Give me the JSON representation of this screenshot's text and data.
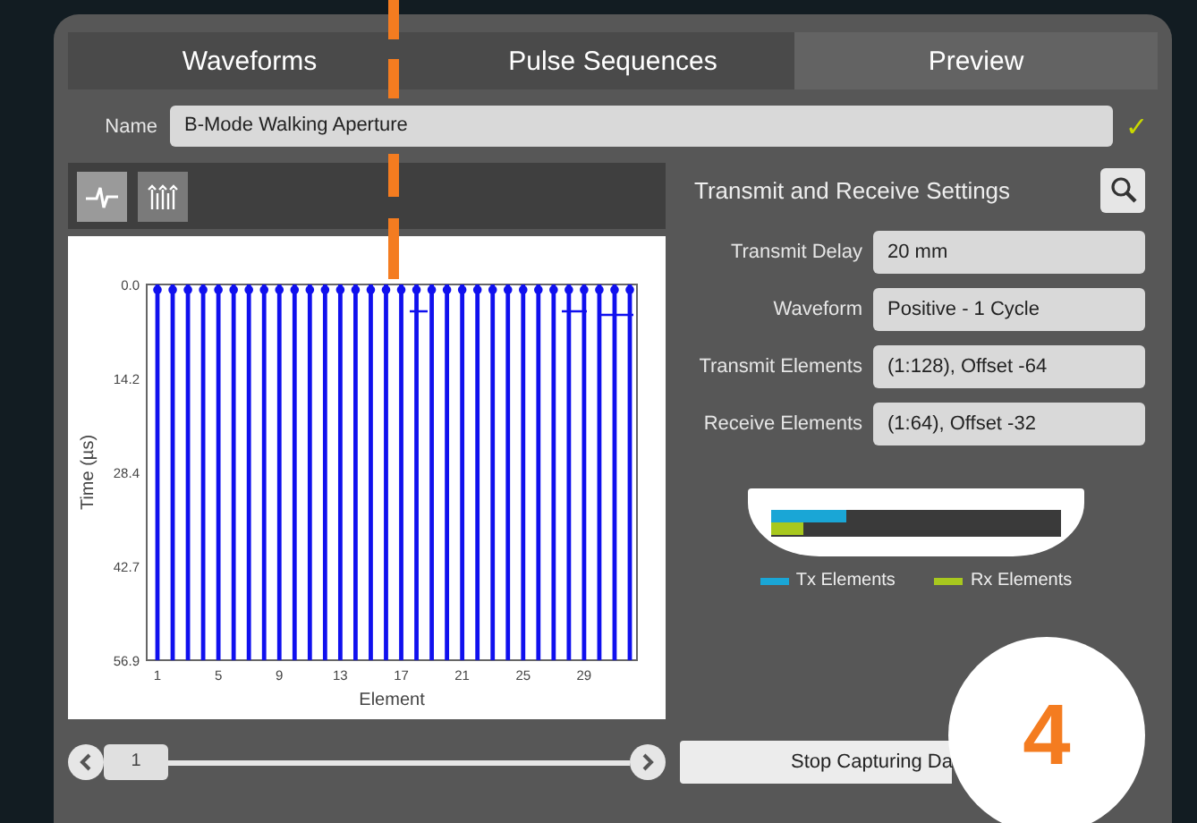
{
  "tabs": [
    {
      "label": "Waveforms",
      "selected": false
    },
    {
      "label": "Pulse Sequences",
      "selected": false
    },
    {
      "label": "Preview",
      "selected": true
    }
  ],
  "name_field": {
    "label": "Name",
    "value": "B-Mode Walking Aperture",
    "valid_mark": "✓"
  },
  "view_toggles": [
    {
      "kind": "waveform",
      "selected": true
    },
    {
      "kind": "sequence",
      "selected": false
    }
  ],
  "plot": {
    "xlabel": "Element",
    "ylabel": "Time (µs)",
    "yticks": [
      "0.0",
      "14.2",
      "28.4",
      "42.7",
      "56.9"
    ],
    "xticks": [
      "1",
      "5",
      "9",
      "13",
      "17",
      "21",
      "25",
      "29"
    ]
  },
  "settings": {
    "title": "Transmit and Receive Settings",
    "fields": [
      {
        "label": "Transmit Delay",
        "value": "20 mm"
      },
      {
        "label": "Waveform",
        "value": "Positive - 1 Cycle"
      },
      {
        "label": "Transmit Elements",
        "value": "(1:128), Offset -64"
      },
      {
        "label": "Receive Elements",
        "value": "(1:64), Offset -32"
      }
    ]
  },
  "aperture": {
    "bars": [
      {
        "level": 0.26,
        "color": "#1aa6d6"
      },
      {
        "level": 0.11,
        "color": "#a8c81e"
      }
    ],
    "legend": [
      {
        "label": "Tx Elements",
        "color": "#1aa6d6"
      },
      {
        "label": "Rx Elements",
        "color": "#a8c81e"
      }
    ]
  },
  "slider": {
    "value": "1",
    "level": 0
  },
  "action_button": {
    "label": "Stop Capturing Da"
  },
  "step_badge": {
    "label": "4"
  }
}
